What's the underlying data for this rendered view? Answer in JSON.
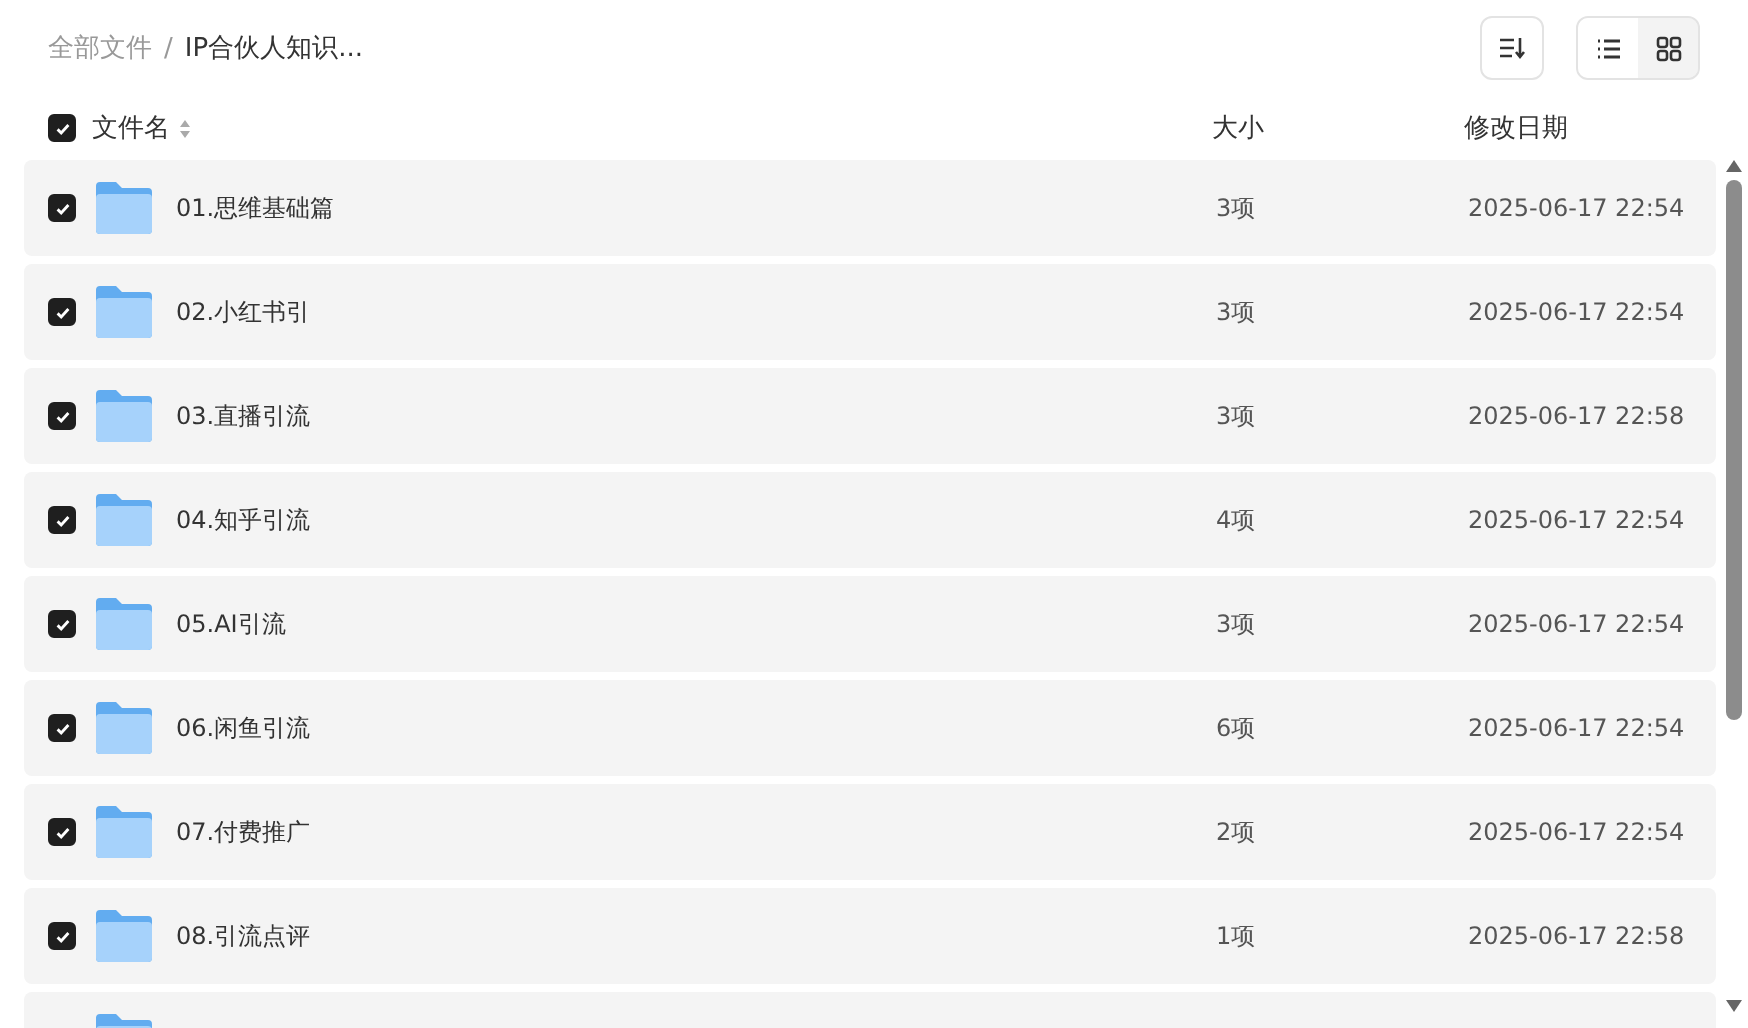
{
  "breadcrumb_separator": "/",
  "breadcrumb": [
    {
      "label": "全部文件",
      "current": false
    },
    {
      "label": "IP合伙人知识...",
      "current": true
    }
  ],
  "view_toggle": [
    {
      "kind": "list",
      "selected": true
    },
    {
      "kind": "grid",
      "selected": false
    }
  ],
  "header": {
    "checked": true,
    "columns": [
      "文件名",
      "大小",
      "修改日期"
    ]
  },
  "rows": [
    {
      "checked": true,
      "name": "01.思维基础篇",
      "size": "3项",
      "date": "2025-06-17 22:54"
    },
    {
      "checked": true,
      "name": "02.小红书引",
      "size": "3项",
      "date": "2025-06-17 22:54"
    },
    {
      "checked": true,
      "name": "03.直播引流",
      "size": "3项",
      "date": "2025-06-17 22:58"
    },
    {
      "checked": true,
      "name": "04.知乎引流",
      "size": "4项",
      "date": "2025-06-17 22:54"
    },
    {
      "checked": true,
      "name": "05.AI引流",
      "size": "3项",
      "date": "2025-06-17 22:54"
    },
    {
      "checked": true,
      "name": "06.闲鱼引流",
      "size": "6项",
      "date": "2025-06-17 22:54"
    },
    {
      "checked": true,
      "name": "07.付费推广",
      "size": "2项",
      "date": "2025-06-17 22:54"
    },
    {
      "checked": true,
      "name": "08.引流点评",
      "size": "1项",
      "date": "2025-06-17 22:58"
    }
  ],
  "more_rows_below": true
}
